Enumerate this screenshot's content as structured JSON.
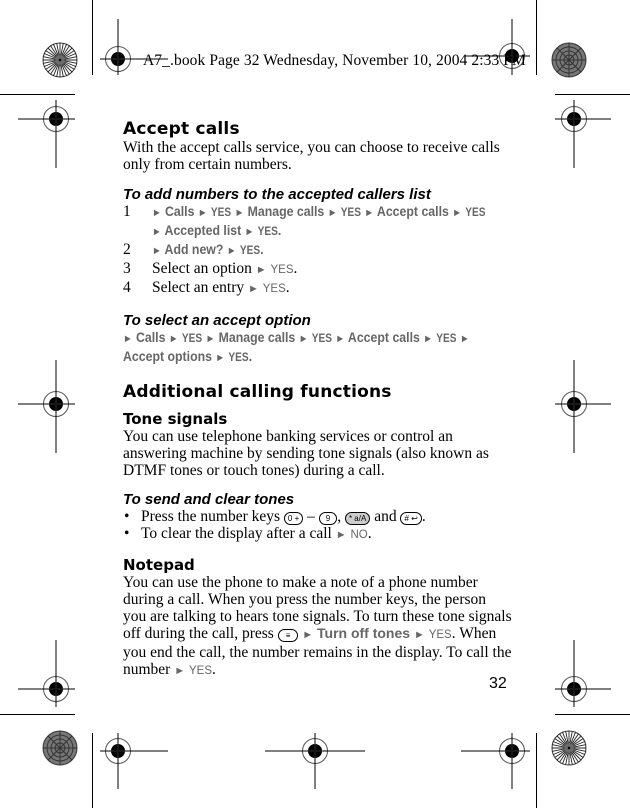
{
  "header_note": "A7_.book  Page 32  Wednesday, November 10, 2004  2:33 PM",
  "page_number": "32",
  "sections": {
    "accept_calls": {
      "title": "Accept calls",
      "intro": "With the accept calls service, you can choose to receive calls only from certain numbers.",
      "add_numbers": {
        "title": "To add numbers to the accepted callers list",
        "steps": [
          {
            "num": "1",
            "parts": [
              "Calls",
              "YES",
              "Manage calls",
              "YES",
              "Accept calls",
              "YES"
            ],
            "parts2": [
              "Accepted list",
              "YES"
            ]
          },
          {
            "num": "2",
            "parts": [
              "Add new?",
              "YES"
            ]
          },
          {
            "num": "3",
            "text": "Select an option",
            "key": "YES"
          },
          {
            "num": "4",
            "text": "Select an entry",
            "key": "YES"
          }
        ]
      },
      "select_option": {
        "title": "To select an accept option",
        "path1": [
          "Calls",
          "YES",
          "Manage calls",
          "YES",
          "Accept calls",
          "YES"
        ],
        "path2": [
          "Accept options",
          "YES"
        ]
      }
    },
    "additional": {
      "title": "Additional calling functions",
      "tone_signals": {
        "title": "Tone signals",
        "body": "You can use telephone banking services or control an answering machine by sending tone signals (also known as DTMF tones or touch tones) during a call.",
        "send_clear": {
          "title": "To send and clear tones",
          "bullet1_prefix": "Press the number keys",
          "keys": [
            "0 +",
            "9",
            "* a/A",
            "# ↩"
          ],
          "dash": "–",
          "comma": ",",
          "and": "and",
          "period": ".",
          "bullet2_text": "To clear the display after a call",
          "bullet2_key": "NO"
        }
      },
      "notepad": {
        "title": "Notepad",
        "body_1": "You can use the phone to make a note of a phone number during a call. When you press the number keys, the person you are talking to hears tone signals. To turn these tone signals off during the call, press",
        "menu_key": "≡",
        "menu_item": "Turn off tones",
        "key_yes": "YES",
        "body_2": "When you end the call, the number remains in the display. To call the number",
        "key_yes_2": "YES"
      }
    }
  },
  "icons": {
    "arrow": "►",
    "bullet": "•"
  }
}
